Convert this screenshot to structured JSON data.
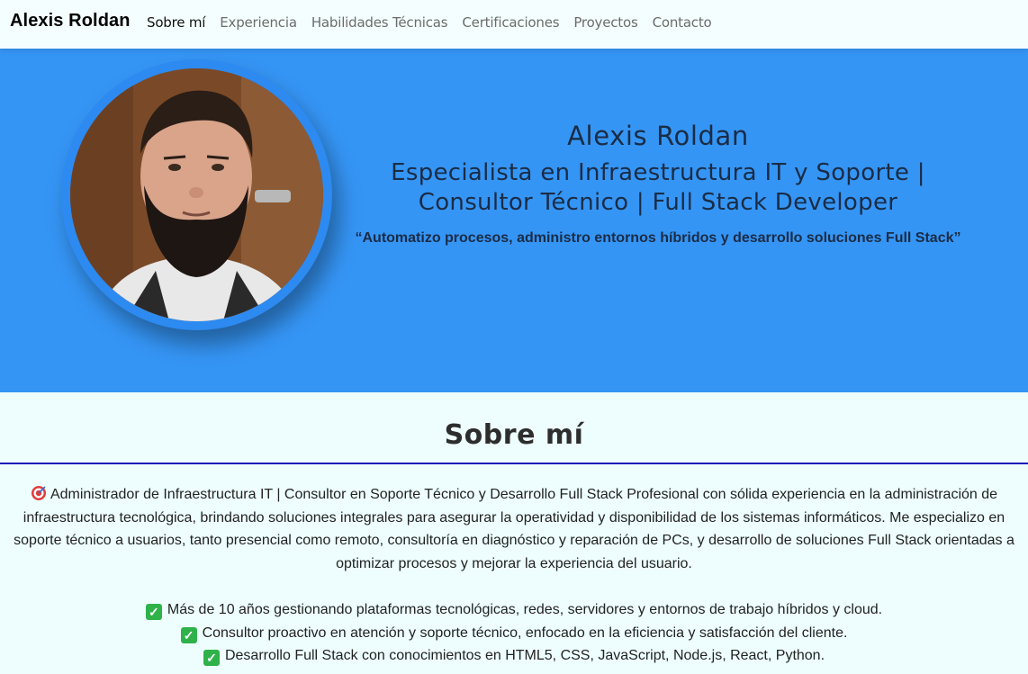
{
  "navbar": {
    "brand": "Alexis Roldan",
    "items": [
      {
        "label": "Sobre mí",
        "active": true
      },
      {
        "label": "Experiencia",
        "active": false
      },
      {
        "label": "Habilidades Técnicas",
        "active": false
      },
      {
        "label": "Certificaciones",
        "active": false
      },
      {
        "label": "Proyectos",
        "active": false
      },
      {
        "label": "Contacto",
        "active": false
      }
    ]
  },
  "hero": {
    "name": "Alexis Roldan",
    "role_line1": "Especialista en Infraestructura IT y Soporte |",
    "role_line2": "Consultor Técnico | Full Stack Developer",
    "quote": "“Automatizo procesos, administro entornos híbridos y desarrollo soluciones Full Stack”",
    "background_color": "#3595f5"
  },
  "about": {
    "title": "Sobre mí",
    "intro_icon": "target-icon",
    "intro": "Administrador de Infraestructura IT | Consultor en Soporte Técnico y Desarrollo Full Stack Profesional con sólida experiencia en la administración de infraestructura tecnológica, brindando soluciones integrales para asegurar la operatividad y disponibilidad de los sistemas informáticos. Me especializo en soporte técnico a usuarios, tanto presencial como remoto, consultoría en diagnóstico y reparación de PCs, y desarrollo de soluciones Full Stack orientadas a optimizar procesos y mejorar la experiencia del usuario.",
    "check_icon": "check-mark-icon",
    "highlights": [
      "Más de 10 años gestionando plataformas tecnológicas, redes, servidores y entornos de trabajo híbridos y cloud.",
      "Consultor proactivo en atención y soporte técnico, enfocado en la eficiencia y satisfacción del cliente.",
      "Desarrollo Full Stack con conocimientos en HTML5, CSS, JavaScript, Node.js, React, Python."
    ]
  }
}
